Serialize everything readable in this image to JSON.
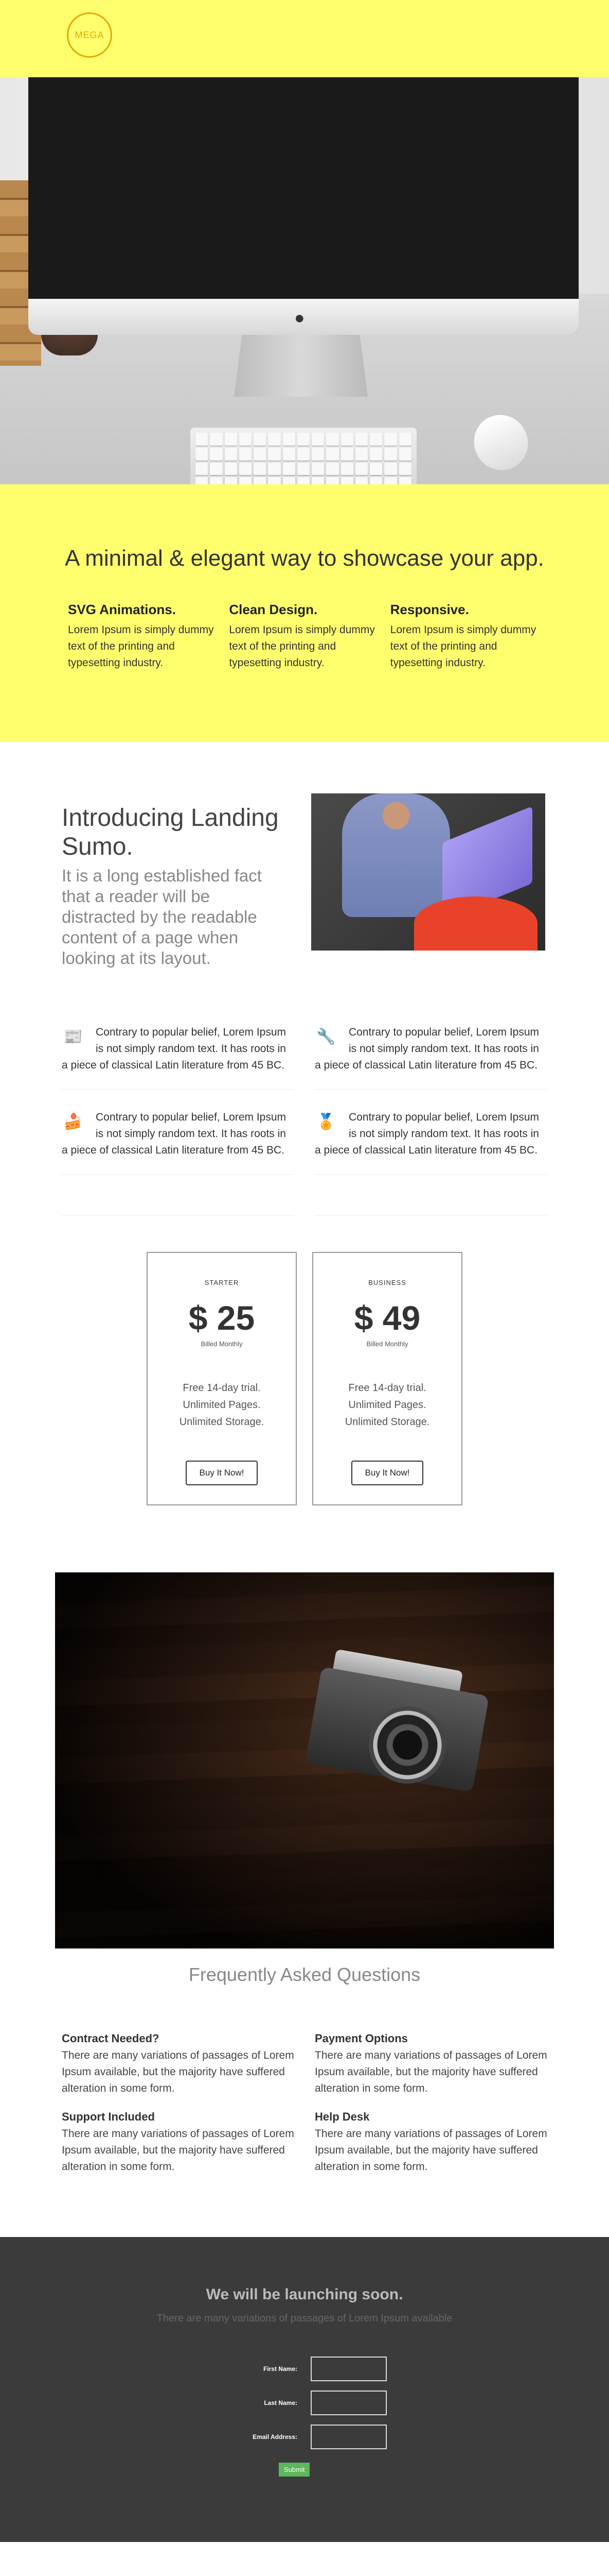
{
  "brand": {
    "logo_text": "MEGA"
  },
  "intro": {
    "headline": "A minimal & elegant way to showcase your app.",
    "features": [
      {
        "title": "SVG Animations.",
        "text": "Lorem Ipsum is simply dummy text of the printing and typesetting industry."
      },
      {
        "title": "Clean Design.",
        "text": "Lorem Ipsum is simply dummy text of the printing and typesetting industry."
      },
      {
        "title": "Responsive.",
        "text": "Lorem Ipsum is simply dummy text of the printing and typesetting industry."
      }
    ]
  },
  "sumo": {
    "title": "Introducing Landing Sumo.",
    "text": "It is a long established fact that a reader will be distracted by the readable content of a page when looking at its layout."
  },
  "icon_features": [
    {
      "icon": "newspaper-icon",
      "text": "Contrary to popular belief, Lorem Ipsum is not simply random text. It has roots in a piece of classical Latin literature from 45 BC."
    },
    {
      "icon": "tools-icon",
      "text": "Contrary to popular belief, Lorem Ipsum is not simply random text. It has roots in a piece of classical Latin literature from 45 BC."
    },
    {
      "icon": "cake-icon",
      "text": "Contrary to popular belief, Lorem Ipsum is not simply random text. It has roots in a piece of classical Latin literature from 45 BC."
    },
    {
      "icon": "medal-icon",
      "text": "Contrary to popular belief, Lorem Ipsum is not simply random text. It has roots in a piece of classical Latin literature from 45 BC."
    }
  ],
  "pricing": [
    {
      "name": "STARTER",
      "price": "$ 25",
      "billing": "Billed Monthly",
      "features": [
        "Free 14-day trial.",
        "Unlimited Pages.",
        "Unlimited Storage."
      ],
      "cta": "Buy It Now!"
    },
    {
      "name": "BUSINESS",
      "price": "$ 49",
      "billing": "Billed Monthly",
      "features": [
        "Free 14-day trial.",
        "Unlimited Pages.",
        "Unlimited Storage."
      ],
      "cta": "Buy It Now!"
    }
  ],
  "faq": {
    "title": "Frequently Asked Questions",
    "items": [
      {
        "q": "Contract Needed?",
        "a": "There are many variations of passages of Lorem Ipsum available, but the majority have suffered alteration in some form."
      },
      {
        "q": "Payment Options",
        "a": "There are many variations of passages of Lorem Ipsum available, but the majority have suffered alteration in some form."
      },
      {
        "q": "Support Included",
        "a": "There are many variations of passages of Lorem Ipsum available, but the majority have suffered alteration in some form."
      },
      {
        "q": "Help Desk",
        "a": "There are many variations of passages of Lorem Ipsum available, but the majority have suffered alteration in some form."
      }
    ]
  },
  "signup": {
    "title": "We will be launching soon.",
    "subtitle": "There are many variations of passages of Lorem Ipsum available",
    "fields": [
      "First Name:",
      "Last Name:",
      "Email Address:"
    ],
    "submit": "Submit"
  },
  "colors": {
    "accent_yellow": "#ffff6e",
    "logo_orange": "#e6a800",
    "footer_bg": "#3b3b3b",
    "submit_green": "#5cb85c"
  }
}
